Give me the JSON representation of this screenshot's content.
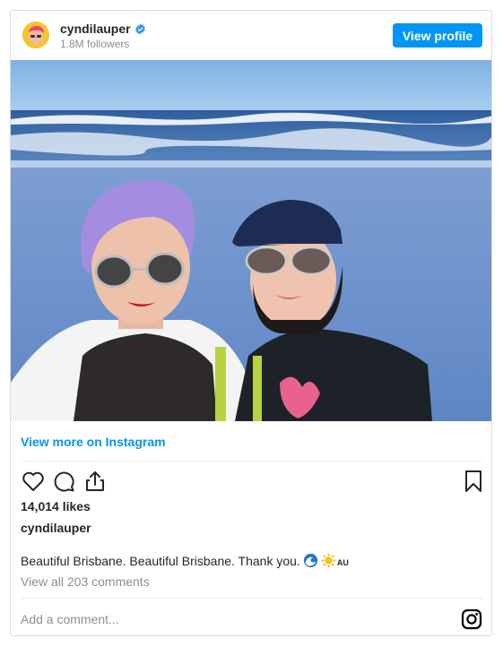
{
  "profile": {
    "username": "cyndilauper",
    "followers": "1.8M followers",
    "view_profile_label": "View profile"
  },
  "post": {
    "view_more_label": "View more on Instagram",
    "likes": "14,014 likes",
    "caption_username": "cyndilauper",
    "caption": "Beautiful Brisbane. Beautiful Brisbane. Thank you.",
    "caption_tag": "AU",
    "view_comments": "View all 203 comments",
    "add_comment_placeholder": "Add a comment..."
  },
  "icons": [
    "verified-badge-icon",
    "heart-icon",
    "comment-icon",
    "share-icon",
    "bookmark-icon",
    "wave-emoji-icon",
    "sun-emoji-icon",
    "instagram-icon"
  ],
  "colors": {
    "accent": "#0095f6",
    "muted": "#8e8e8e",
    "text": "#262626"
  }
}
